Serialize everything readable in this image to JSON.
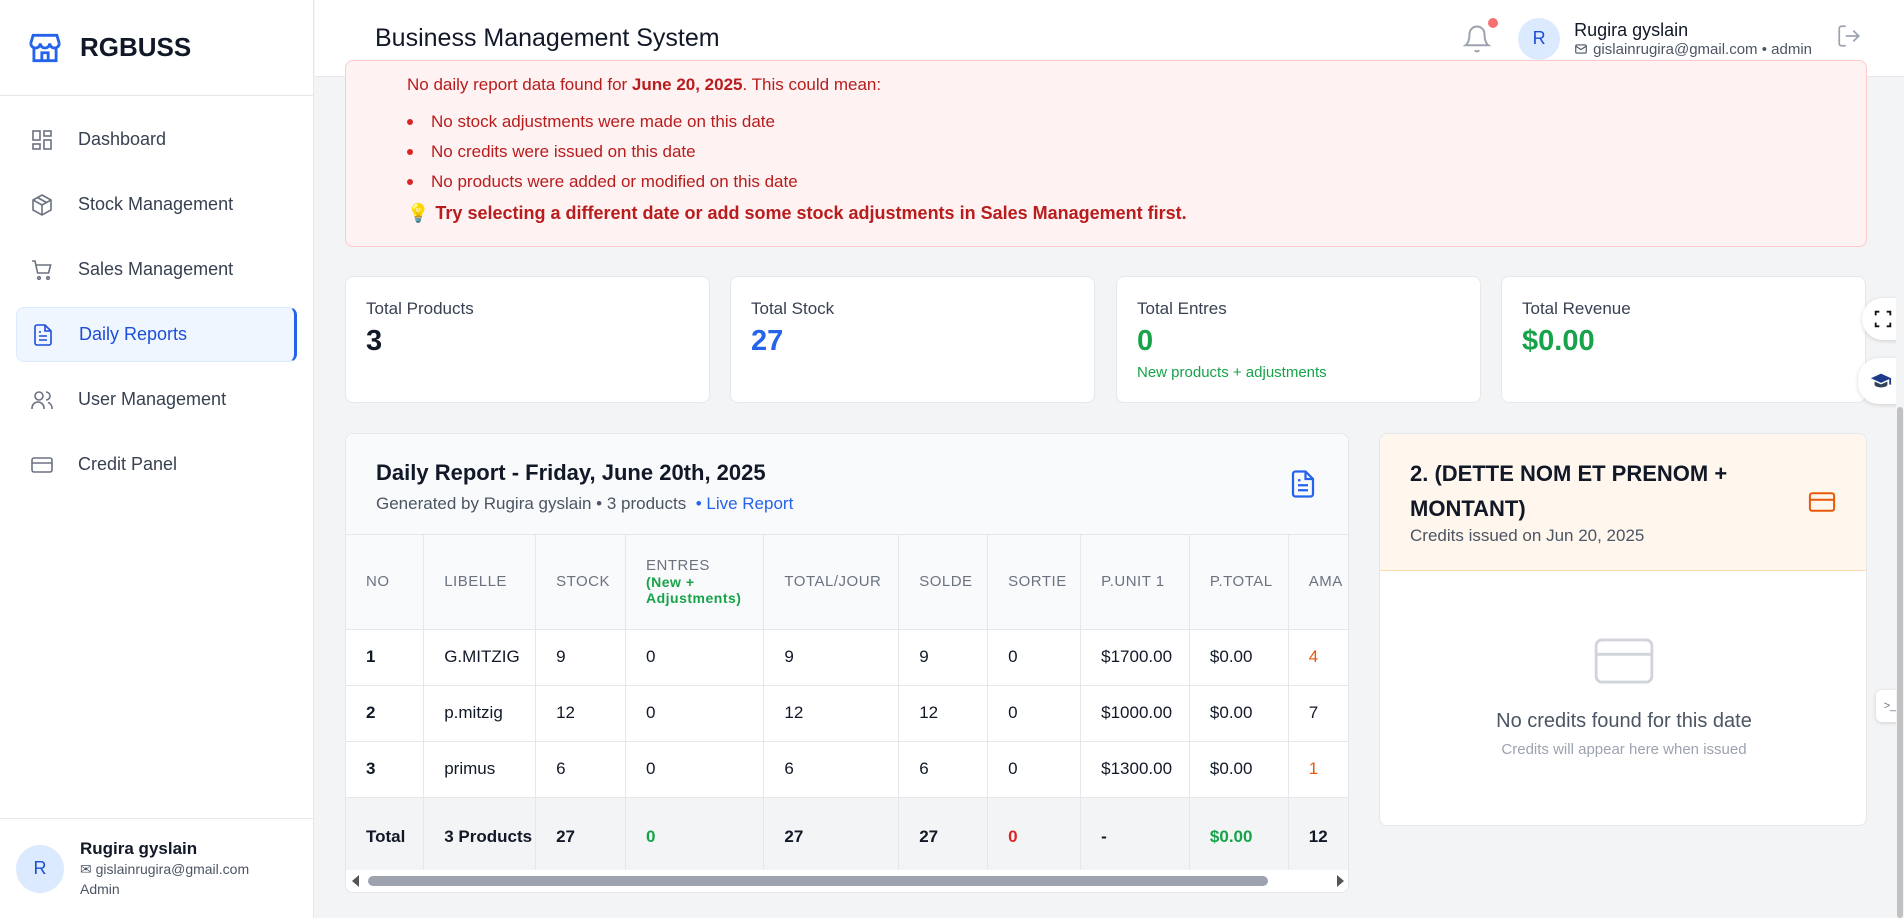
{
  "brand": {
    "name": "RGBUSS",
    "accent": "#2563eb"
  },
  "sidebar": {
    "items": [
      {
        "label": "Dashboard",
        "icon": "dashboard-icon"
      },
      {
        "label": "Stock Management",
        "icon": "box-icon"
      },
      {
        "label": "Sales Management",
        "icon": "cart-icon"
      },
      {
        "label": "Daily Reports",
        "icon": "document-icon",
        "active": true
      },
      {
        "label": "User Management",
        "icon": "users-icon"
      },
      {
        "label": "Credit Panel",
        "icon": "credit-card-icon"
      }
    ],
    "user": {
      "initial": "R",
      "name": "Rugira gyslain",
      "email": "gislainrugira@gmail.com",
      "role": "Admin"
    }
  },
  "header": {
    "title": "Business Management System",
    "user": {
      "initial": "R",
      "name": "Rugira gyslain",
      "email": "gislainrugira@gmail.com",
      "role_suffix": "• admin"
    }
  },
  "alert": {
    "lead_prefix": "No daily report data found for ",
    "lead_date": "June 20, 2025",
    "lead_suffix": ". This could mean:",
    "items": [
      "No stock adjustments were made on this date",
      "No credits were issued on this date",
      "No products were added or modified on this date"
    ],
    "tip": "Try selecting a different date or add some stock adjustments in Sales Management first."
  },
  "stats": [
    {
      "label": "Total Products",
      "value": "3",
      "color": "#111827"
    },
    {
      "label": "Total Stock",
      "value": "27",
      "color": "#2563eb"
    },
    {
      "label": "Total Entres",
      "value": "0",
      "color": "#16a34a",
      "sub": "New products + adjustments"
    },
    {
      "label": "Total Revenue",
      "value": "$0.00",
      "color": "#16a34a"
    }
  ],
  "report": {
    "title": "Daily Report - Friday, June 20th, 2025",
    "subtitle": "Generated by Rugira gyslain • 3 products",
    "live": "• Live Report",
    "columns": [
      "NO",
      "LIBELLE",
      "STOCK",
      "ENTRES",
      "TOTAL/JOUR",
      "SOLDE",
      "SORTIE",
      "P.UNIT 1",
      "P.TOTAL",
      "AMA"
    ],
    "entres_sub": "(New + Adjustments)",
    "rows": [
      [
        "1",
        "G.MITZIG",
        "9",
        "0",
        "9",
        "9",
        "0",
        "$1700.00",
        "$0.00",
        "4"
      ],
      [
        "2",
        "p.mitzig",
        "12",
        "0",
        "12",
        "12",
        "0",
        "$1000.00",
        "$0.00",
        "7"
      ],
      [
        "3",
        "primus",
        "6",
        "0",
        "6",
        "6",
        "0",
        "$1300.00",
        "$0.00",
        "1"
      ]
    ],
    "total": [
      "Total",
      "3 Products",
      "27",
      "0",
      "27",
      "27",
      "0",
      "-",
      "$0.00",
      "12"
    ]
  },
  "credits": {
    "title": "2. (DETTE NOM ET PRENOM + MONTANT)",
    "subtitle": "Credits issued on Jun 20, 2025",
    "empty_title": "No credits found for this date",
    "empty_sub": "Credits will appear here when issued"
  }
}
